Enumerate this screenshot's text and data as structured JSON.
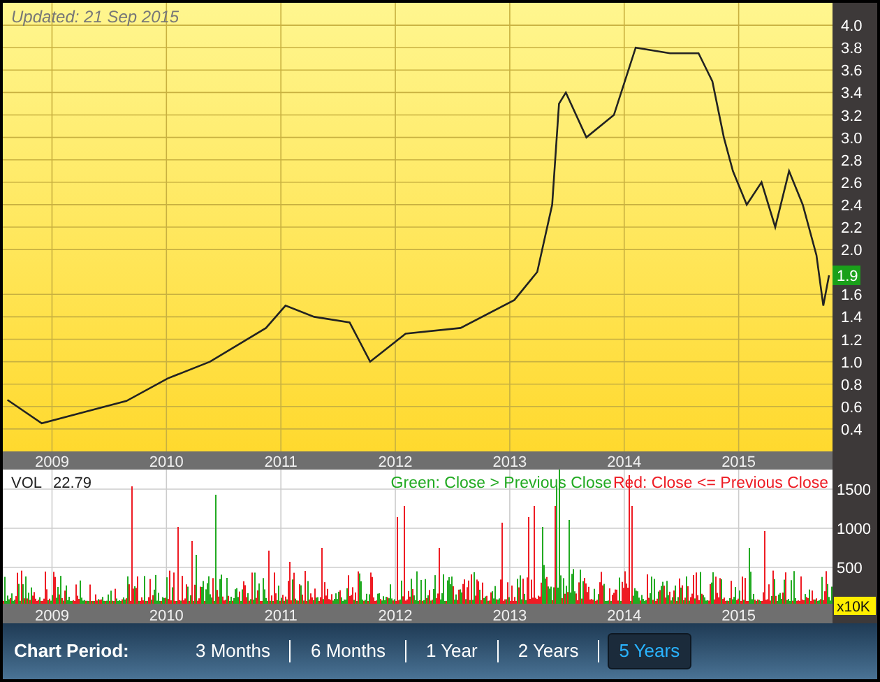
{
  "chart": {
    "updated": "Updated: 21 Sep 2015",
    "last_price": "1.9",
    "chart_data": {
      "type": "line",
      "x": [
        2008.61,
        2008.91,
        2009.28,
        2009.65,
        2010.01,
        2010.38,
        2010.87,
        2011.04,
        2011.29,
        2011.6,
        2011.78,
        2012.09,
        2012.57,
        2013.04,
        2013.24,
        2013.37,
        2013.43,
        2013.49,
        2013.67,
        2013.91,
        2014.1,
        2014.4,
        2014.65,
        2014.77,
        2014.87,
        2014.95,
        2015.07,
        2015.2,
        2015.32,
        2015.44,
        2015.56,
        2015.68,
        2015.74,
        2015.79
      ],
      "series": [
        {
          "color": "#222222",
          "values": [
            0.66,
            0.45,
            0.55,
            0.65,
            0.85,
            1.0,
            1.3,
            1.5,
            1.4,
            1.35,
            1.0,
            1.25,
            1.3,
            1.55,
            1.8,
            2.4,
            3.3,
            3.4,
            3.0,
            3.2,
            3.8,
            3.75,
            3.75,
            3.5,
            3.0,
            2.7,
            2.4,
            2.6,
            2.2,
            2.7,
            2.4,
            1.95,
            1.5,
            1.77
          ]
        }
      ],
      "xlim": [
        2008.57,
        2015.82
      ],
      "ylim": [
        0.2,
        4.2
      ],
      "grid": true,
      "xticks": [
        {
          "value": 2009,
          "label": "2009"
        },
        {
          "value": 2010,
          "label": "2010"
        },
        {
          "value": 2011,
          "label": "2011"
        },
        {
          "value": 2012,
          "label": "2012"
        },
        {
          "value": 2013,
          "label": "2013"
        },
        {
          "value": 2014,
          "label": "2014"
        },
        {
          "value": 2015,
          "label": "2015"
        }
      ],
      "yticks": [
        {
          "value": 4.0,
          "label": "4.0"
        },
        {
          "value": 3.8,
          "label": "3.8"
        },
        {
          "value": 3.6,
          "label": "3.6"
        },
        {
          "value": 3.4,
          "label": "3.4"
        },
        {
          "value": 3.2,
          "label": "3.2"
        },
        {
          "value": 3.0,
          "label": "3.0"
        },
        {
          "value": 2.8,
          "label": "2.8"
        },
        {
          "value": 2.6,
          "label": "2.6"
        },
        {
          "value": 2.4,
          "label": "2.4"
        },
        {
          "value": 2.2,
          "label": "2.2"
        },
        {
          "value": 2.0,
          "label": "2.0"
        },
        {
          "value": 1.6,
          "label": "1.6"
        },
        {
          "value": 1.4,
          "label": "1.4"
        },
        {
          "value": 1.2,
          "label": "1.2"
        },
        {
          "value": 1.0,
          "label": "1.0"
        },
        {
          "value": 0.8,
          "label": "0.8"
        },
        {
          "value": 0.6,
          "label": "0.6"
        },
        {
          "value": 0.4,
          "label": "0.4"
        }
      ]
    }
  },
  "volume": {
    "label": "VOL",
    "value": "22.79",
    "legend": [
      {
        "text": "Green: Close > Previous Close",
        "color": "#22aa22"
      },
      {
        "text": "Red: Close <= Previous Close",
        "color": "#ee1c24"
      }
    ],
    "yticks": [
      "1500",
      "1000",
      "500"
    ],
    "unit": "x10K",
    "xticks": [
      "2009",
      "2010",
      "2011",
      "2012",
      "2013",
      "2014",
      "2015"
    ]
  },
  "period_bar": {
    "label": "Chart Period:",
    "options": [
      {
        "label": "3 Months",
        "selected": false
      },
      {
        "label": "6 Months",
        "selected": false
      },
      {
        "label": "1 Year",
        "selected": false
      },
      {
        "label": "2 Years",
        "selected": false
      },
      {
        "label": "5 Years",
        "selected": true
      }
    ]
  }
}
